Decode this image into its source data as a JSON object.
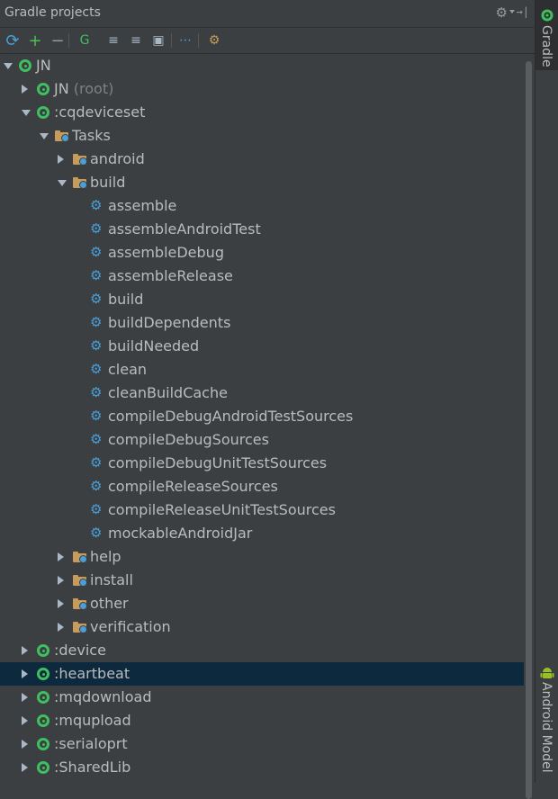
{
  "panel": {
    "title": "Gradle projects"
  },
  "toolbar": {
    "buttons": [
      {
        "name": "refresh-all-button",
        "glyph": "⟳",
        "color": "#4a9fd8"
      },
      {
        "name": "add-project-button",
        "glyph": "+",
        "color": "#4fbf4f"
      },
      {
        "name": "remove-project-button",
        "glyph": "−",
        "color": "#9a9a9a"
      },
      {
        "name": "execute-task-button",
        "glyph": "G",
        "color": "#3fbf5f"
      },
      {
        "name": "expand-all-button",
        "glyph": "≡",
        "color": "#a9b7c6"
      },
      {
        "name": "collapse-all-button",
        "glyph": "≡",
        "color": "#a9b7c6"
      },
      {
        "name": "attach-project-button",
        "glyph": "▣",
        "color": "#a9b7c6"
      },
      {
        "name": "offline-mode-button",
        "glyph": "⋯",
        "color": "#4a9fd8"
      },
      {
        "name": "gradle-settings-button",
        "glyph": "⚙",
        "color": "#c69b5b"
      }
    ]
  },
  "tree": [
    {
      "label": "JN",
      "type": "project",
      "state": "expanded",
      "level": 0
    },
    {
      "label": "JN",
      "suffix": "(root)",
      "type": "project",
      "state": "collapsed",
      "level": 1
    },
    {
      "label": ":cqdeviceset",
      "type": "project",
      "state": "expanded",
      "level": 1
    },
    {
      "label": "Tasks",
      "type": "folder",
      "state": "expanded",
      "level": 2
    },
    {
      "label": "android",
      "type": "folder",
      "state": "collapsed",
      "level": 3
    },
    {
      "label": "build",
      "type": "folder",
      "state": "expanded",
      "level": 3
    },
    {
      "label": "assemble",
      "type": "task",
      "level": 4
    },
    {
      "label": "assembleAndroidTest",
      "type": "task",
      "level": 4
    },
    {
      "label": "assembleDebug",
      "type": "task",
      "level": 4
    },
    {
      "label": "assembleRelease",
      "type": "task",
      "level": 4
    },
    {
      "label": "build",
      "type": "task",
      "level": 4
    },
    {
      "label": "buildDependents",
      "type": "task",
      "level": 4
    },
    {
      "label": "buildNeeded",
      "type": "task",
      "level": 4
    },
    {
      "label": "clean",
      "type": "task",
      "level": 4
    },
    {
      "label": "cleanBuildCache",
      "type": "task",
      "level": 4
    },
    {
      "label": "compileDebugAndroidTestSources",
      "type": "task",
      "level": 4
    },
    {
      "label": "compileDebugSources",
      "type": "task",
      "level": 4
    },
    {
      "label": "compileDebugUnitTestSources",
      "type": "task",
      "level": 4
    },
    {
      "label": "compileReleaseSources",
      "type": "task",
      "level": 4
    },
    {
      "label": "compileReleaseUnitTestSources",
      "type": "task",
      "level": 4
    },
    {
      "label": "mockableAndroidJar",
      "type": "task",
      "level": 4
    },
    {
      "label": "help",
      "type": "folder",
      "state": "collapsed",
      "level": 3
    },
    {
      "label": "install",
      "type": "folder",
      "state": "collapsed",
      "level": 3
    },
    {
      "label": "other",
      "type": "folder",
      "state": "collapsed",
      "level": 3
    },
    {
      "label": "verification",
      "type": "folder",
      "state": "collapsed",
      "level": 3
    },
    {
      "label": ":device",
      "type": "project",
      "state": "collapsed",
      "level": 1
    },
    {
      "label": ":heartbeat",
      "type": "project",
      "state": "collapsed",
      "level": 1,
      "selected": true
    },
    {
      "label": ":mqdownload",
      "type": "project",
      "state": "collapsed",
      "level": 1
    },
    {
      "label": ":mqupload",
      "type": "project",
      "state": "collapsed",
      "level": 1
    },
    {
      "label": ":serialoprt",
      "type": "project",
      "state": "collapsed",
      "level": 1
    },
    {
      "label": ":SharedLib",
      "type": "project",
      "state": "collapsed",
      "level": 1
    }
  ],
  "side_tabs": {
    "gradle": "Gradle",
    "android_model": "Android Model"
  },
  "colors": {
    "background": "#3c3f41",
    "selection": "#0d293e",
    "gradle_green": "#3fbf5f",
    "task_blue": "#4a9fd8",
    "folder_tan": "#c69b5b"
  }
}
